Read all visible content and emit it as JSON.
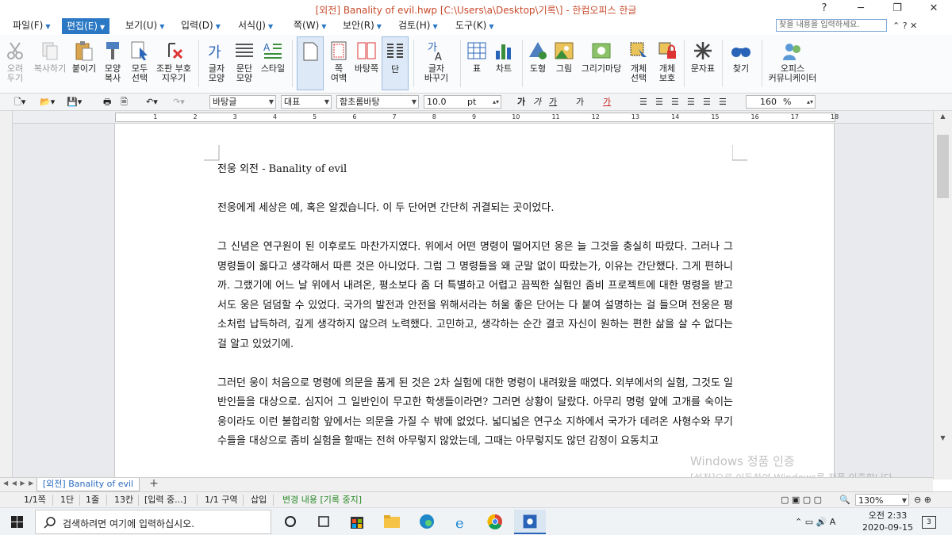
{
  "window": {
    "title": "[외전] Banality of evil.hwp [C:\\Users\\a\\Desktop\\기록\\] - 한컴오피스 한글",
    "controls": [
      "?",
      "─",
      "❐",
      "✕"
    ]
  },
  "menubar": {
    "items": [
      {
        "label": "파일(F)"
      },
      {
        "label": "편집(E)",
        "active": true
      },
      {
        "label": "보기(U)"
      },
      {
        "label": "입력(D)"
      },
      {
        "label": "서식(J)"
      },
      {
        "label": "쪽(W)"
      },
      {
        "label": "보안(R)"
      },
      {
        "label": "검토(H)"
      },
      {
        "label": "도구(K)"
      }
    ],
    "search_placeholder": "찾을 내용을 입력하세요.",
    "right_controls": "⌃  ?  ✕"
  },
  "ribbon": {
    "buttons": [
      {
        "label": "오려\n두기",
        "icon": "scissors-icon",
        "disabled": true
      },
      {
        "label": "복사하기",
        "icon": "copy-icon",
        "disabled": true
      },
      {
        "label": "붙이기",
        "icon": "paste-icon"
      },
      {
        "label": "모양\n복사",
        "icon": "format-painter-icon"
      },
      {
        "label": "모두\n선택",
        "icon": "select-all-icon"
      },
      {
        "label": "조판 부호\n지우기",
        "icon": "clear-format-icon"
      },
      {
        "label": "글자\n모양",
        "icon": "char-shape-icon"
      },
      {
        "label": "문단\n모양",
        "icon": "para-shape-icon"
      },
      {
        "label": "스타일",
        "icon": "style-icon"
      },
      {
        "label": "",
        "icon": "page-icon"
      },
      {
        "label": "쪽\n여백",
        "icon": "margin-icon"
      },
      {
        "label": "바탕쪽",
        "icon": "master-page-icon"
      },
      {
        "label": "단",
        "icon": "columns-icon"
      },
      {
        "label": "글자\n바꾸기",
        "icon": "char-replace-icon"
      },
      {
        "label": "표",
        "icon": "table-icon"
      },
      {
        "label": "차트",
        "icon": "chart-icon"
      },
      {
        "label": "도형",
        "icon": "shape-icon"
      },
      {
        "label": "그림",
        "icon": "picture-icon"
      },
      {
        "label": "그리기마당",
        "icon": "clipart-icon"
      },
      {
        "label": "개체\n선택",
        "icon": "object-select-icon"
      },
      {
        "label": "개체\n보호",
        "icon": "object-protect-icon"
      },
      {
        "label": "문자표",
        "icon": "symbol-icon"
      },
      {
        "label": "찾기",
        "icon": "find-icon"
      },
      {
        "label": "오피스\n커뮤니케이터",
        "icon": "communicator-icon"
      }
    ]
  },
  "format_toolbar": {
    "style": "바탕글",
    "language": "대표",
    "font": "함초롬바탕",
    "font_size": "10.0",
    "size_unit": "pt",
    "char_styles": [
      "가",
      "가",
      "가",
      "가",
      "가"
    ],
    "zoom": "160",
    "zoom_unit": "%"
  },
  "ruler": {
    "numbers": [
      "1",
      "2",
      "3",
      "4",
      "5",
      "6",
      "7",
      "8",
      "9",
      "10",
      "11",
      "12",
      "13",
      "14",
      "15",
      "16",
      "17",
      "18"
    ]
  },
  "document": {
    "title": "전웅 외전 - Banality of evil",
    "paragraphs": [
      "전웅에게 세상은 예, 혹은 알겠습니다. 이 두 단어면 간단히 귀결되는 곳이었다.",
      "그 신념은 연구원이 된 이후로도 마찬가지였다. 위에서 어떤 명령이 떨어지던 웅은 늘 그것을 충실히 따랐다. 그러나 그 명령들이 옳다고 생각해서 따른 것은 아니었다. 그럼 그 명령들을 왜 군말 없이 따랐는가, 이유는 간단했다. 그게 편하니까. 그랬기에 어느 날 위에서 내려온, 평소보다 좀 더 특별하고 어렵고 끔찍한 실험인 좀비 프로젝트에 대한 명령을 받고서도 웅은 덤덤할 수 있었다. 국가의 발전과 안전을 위해서라는 허울 좋은 단어는 다 붙여 설명하는 걸 들으며 전웅은 평소처럼 납득하려, 깊게 생각하지 않으려 노력했다. 고민하고, 생각하는 순간 결코 자신이 원하는 편한 삶을 살 수 없다는 걸 알고 있었기에.",
      "그러던 웅이 처음으로 명령에 의문을 품게 된 것은 2차 실험에 대한 명령이 내려왔을 때였다. 외부에서의 실험, 그것도 일반인들을 대상으로. 심지어 그 일반인이 무고한 학생들이라면? 그러면 상황이 달랐다. 아무리 명령 앞에 고개를 숙이는 웅이라도 이런 불합리함 앞에서는 의문을 가질 수 밖에 없었다. 넓디넓은 연구소 지하에서 국가가 데려온 사형수와 무기수들을 대상으로 좀비 실험을 할때는 전혀 아무렇지 않았는데, 그때는 아무렇지도 않던 감정이 요동치고"
    ]
  },
  "tabs": {
    "nav": "◀ ◀ ▶ ▶",
    "active_tab": "[외전] Banality of evil",
    "add": "+"
  },
  "statusbar": {
    "page": "1/1쪽",
    "column": "1단",
    "line": "1줄",
    "col": "13칸",
    "mode": "[입력 중...]",
    "section": "1/1 구역",
    "insert": "삽입",
    "track": "변경 내용 [기록 중지]",
    "zoom": "130%"
  },
  "watermark": {
    "line1": "Windows 정품 인증",
    "line2": "[설정]으로 이동하여 Windows를 정품 인증합니다."
  },
  "taskbar": {
    "search_placeholder": "검색하려면 여기에 입력하십시오.",
    "time": "오전 2:33",
    "date": "2020-09-15",
    "notification_count": "3"
  }
}
